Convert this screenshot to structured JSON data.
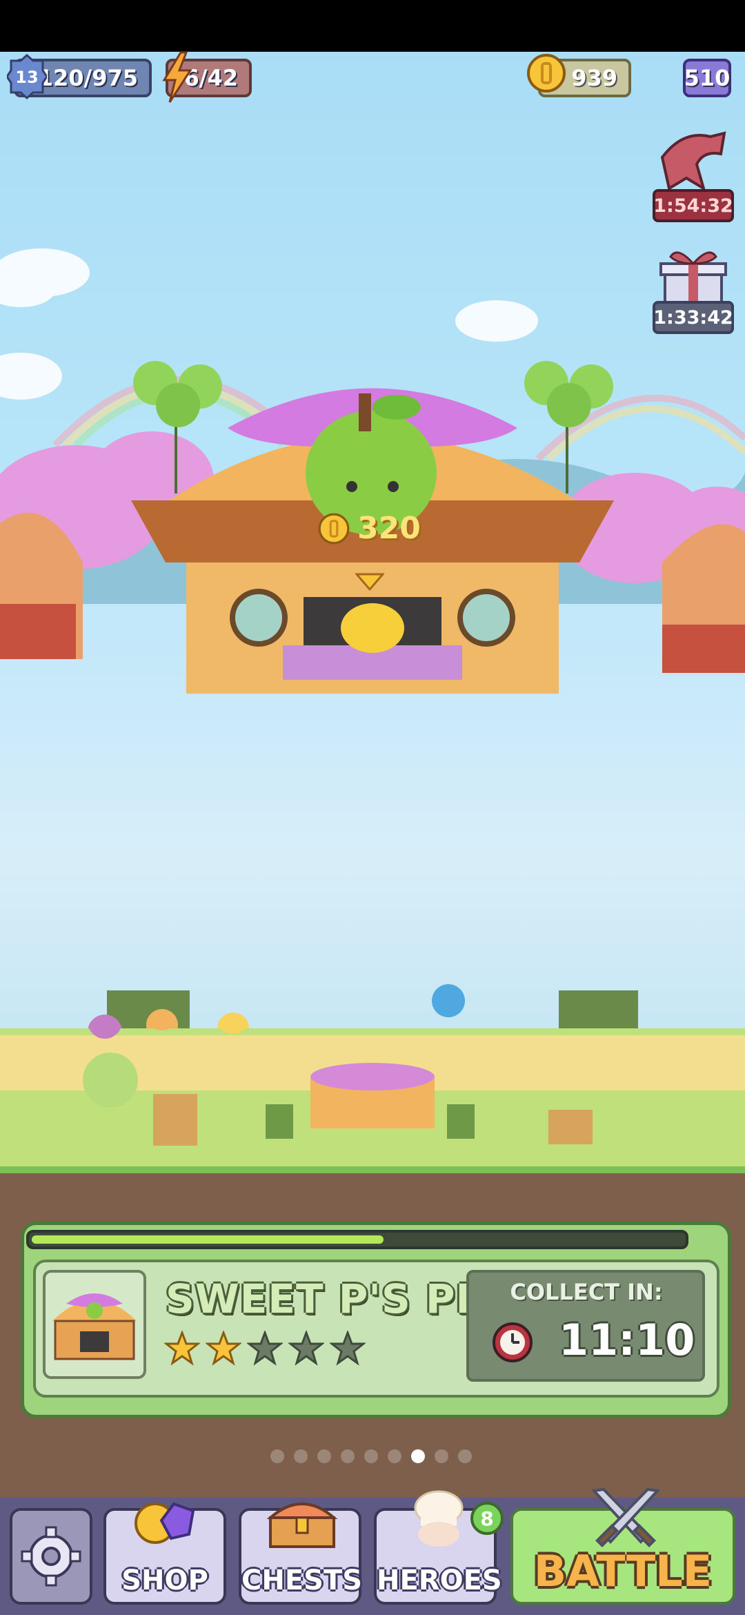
{
  "hud": {
    "level": "13",
    "xp": "120/975",
    "energy": "6/42",
    "coins": "939",
    "gems": "510"
  },
  "timers": {
    "first": "1:54:32",
    "second": "1:33:42"
  },
  "reward": {
    "coins": "320"
  },
  "shop": {
    "name": "SWEET P'S PIES",
    "stars_filled": 2,
    "stars_total": 5,
    "progress": 0.54,
    "collect_label": "COLLECT IN:",
    "collect_time": "11:10"
  },
  "pager": {
    "count": 9,
    "active_index": 6
  },
  "nav": {
    "shop": "SHOP",
    "chests": "CHESTS",
    "heroes": "HEROES",
    "heroes_badge": "8",
    "battle": "BATTLE"
  },
  "colors": {
    "sky": "#a9ddf6",
    "panel_green": "#9ed57c",
    "battle_orange": "#f6b44a",
    "nav_bg": "#5e5a83"
  }
}
